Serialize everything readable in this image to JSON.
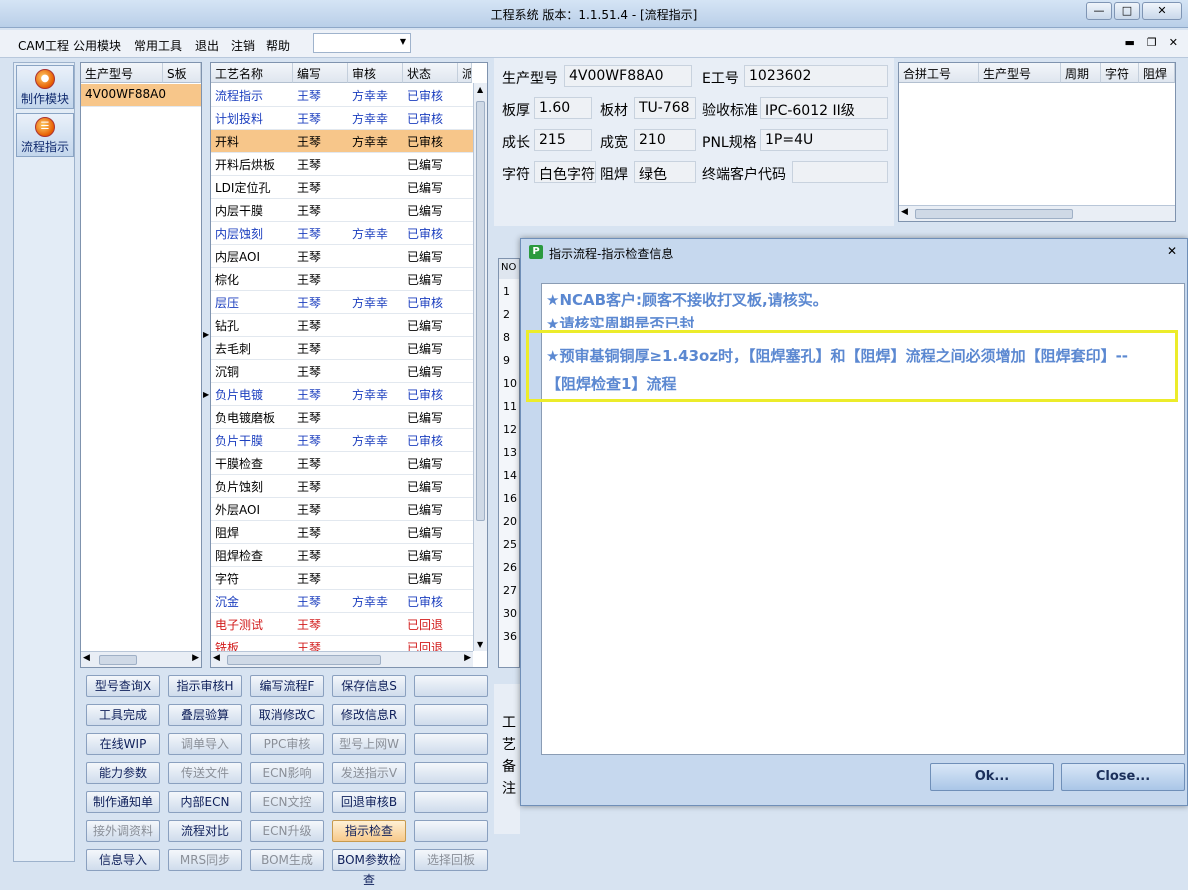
{
  "window": {
    "title": "工程系统   版本：1.1.51.4 - [流程指示]"
  },
  "menu": {
    "items": [
      "CAM工程",
      "公用模块",
      "常用工具",
      "退出",
      "注销",
      "帮助"
    ],
    "combo_value": ""
  },
  "sidebar": {
    "items": [
      {
        "label": "制作模块"
      },
      {
        "label": "流程指示"
      }
    ]
  },
  "product_list": {
    "headers": [
      "生产型号",
      "S板"
    ],
    "rows": [
      {
        "model": "4V00WF88A0",
        "s": ""
      }
    ]
  },
  "process_table": {
    "headers": [
      "工艺名称",
      "编写",
      "审核",
      "状态",
      "派"
    ],
    "rows": [
      {
        "name": "流程指示",
        "writer": "王琴",
        "reviewer": "方幸幸",
        "status": "已审核",
        "color": "blue"
      },
      {
        "name": "计划投料",
        "writer": "王琴",
        "reviewer": "方幸幸",
        "status": "已审核",
        "color": "blue"
      },
      {
        "name": "开料",
        "writer": "王琴",
        "reviewer": "方幸幸",
        "status": "已审核",
        "color": "blue"
      },
      {
        "name": "开料后烘板",
        "writer": "王琴",
        "reviewer": "",
        "status": "已编写",
        "color": ""
      },
      {
        "name": "LDI定位孔",
        "writer": "王琴",
        "reviewer": "",
        "status": "已编写",
        "color": ""
      },
      {
        "name": "内层干膜",
        "writer": "王琴",
        "reviewer": "",
        "status": "已编写",
        "color": ""
      },
      {
        "name": "内层蚀刻",
        "writer": "王琴",
        "reviewer": "方幸幸",
        "status": "已审核",
        "color": "blue"
      },
      {
        "name": "内层AOI",
        "writer": "王琴",
        "reviewer": "",
        "status": "已编写",
        "color": ""
      },
      {
        "name": "棕化",
        "writer": "王琴",
        "reviewer": "",
        "status": "已编写",
        "color": ""
      },
      {
        "name": "层压",
        "writer": "王琴",
        "reviewer": "方幸幸",
        "status": "已审核",
        "color": "blue"
      },
      {
        "name": "钻孔",
        "writer": "王琴",
        "reviewer": "",
        "status": "已编写",
        "color": ""
      },
      {
        "name": "去毛刺",
        "writer": "王琴",
        "reviewer": "",
        "status": "已编写",
        "color": ""
      },
      {
        "name": "沉铜",
        "writer": "王琴",
        "reviewer": "",
        "status": "已编写",
        "color": ""
      },
      {
        "name": "负片电镀",
        "writer": "王琴",
        "reviewer": "方幸幸",
        "status": "已审核",
        "color": "blue"
      },
      {
        "name": "负电镀磨板",
        "writer": "王琴",
        "reviewer": "",
        "status": "已编写",
        "color": ""
      },
      {
        "name": "负片干膜",
        "writer": "王琴",
        "reviewer": "方幸幸",
        "status": "已审核",
        "color": "blue"
      },
      {
        "name": "干膜检查",
        "writer": "王琴",
        "reviewer": "",
        "status": "已编写",
        "color": ""
      },
      {
        "name": "负片蚀刻",
        "writer": "王琴",
        "reviewer": "",
        "status": "已编写",
        "color": ""
      },
      {
        "name": "外层AOI",
        "writer": "王琴",
        "reviewer": "",
        "status": "已编写",
        "color": ""
      },
      {
        "name": "阻焊",
        "writer": "王琴",
        "reviewer": "",
        "status": "已编写",
        "color": ""
      },
      {
        "name": "阻焊检查",
        "writer": "王琴",
        "reviewer": "",
        "status": "已编写",
        "color": ""
      },
      {
        "name": "字符",
        "writer": "王琴",
        "reviewer": "",
        "status": "已编写",
        "color": ""
      },
      {
        "name": "沉金",
        "writer": "王琴",
        "reviewer": "方幸幸",
        "status": "已审核",
        "color": "blue"
      },
      {
        "name": "电子测试",
        "writer": "王琴",
        "reviewer": "",
        "status": "已回退",
        "color": "red"
      },
      {
        "name": "铣板",
        "writer": "王琴",
        "reviewer": "",
        "status": "已回退",
        "color": "red"
      }
    ],
    "selected_index": 2
  },
  "info": {
    "model_label": "生产型号",
    "model_value": "4V00WF88A0",
    "eno_label": "E工号",
    "eno_value": "1023602",
    "thick_label": "板厚",
    "thick_value": "1.60",
    "material_label": "板材",
    "material_value": "TU-768",
    "std_label": "验收标准",
    "std_value": "IPC-6012 II级",
    "len_label": "成长",
    "len_value": "215",
    "wid_label": "成宽",
    "wid_value": "210",
    "pnl_label": "PNL规格",
    "pnl_value": "1P=4U",
    "char_label": "字符",
    "char_value": "白色字符",
    "mask_label": "阻焊",
    "mask_value": "绿色",
    "cust_label": "终端客户代码",
    "cust_value": ""
  },
  "merge_table": {
    "headers": [
      "合拼工号",
      "生产型号",
      "周期",
      "字符",
      "阻焊"
    ]
  },
  "no_column": {
    "header": "NO",
    "values": [
      "1",
      "2",
      "8",
      "9",
      "10",
      "11",
      "12",
      "13",
      "14",
      "16",
      "20",
      "25",
      "26",
      "27",
      "30",
      "36"
    ]
  },
  "remark_label": [
    "工",
    "艺",
    "备",
    "注"
  ],
  "actions": [
    [
      "型号查询X",
      "指示审核H",
      "编写流程F",
      "保存信息S",
      ""
    ],
    [
      "工具完成",
      "叠层验算",
      "取消修改C",
      "修改信息R",
      ""
    ],
    [
      "在线WIP",
      "调单导入",
      "PPC审核",
      "型号上网W",
      ""
    ],
    [
      "能力参数",
      "传送文件",
      "ECN影响",
      "发送指示V",
      ""
    ],
    [
      "制作通知单",
      "内部ECN",
      "ECN文控",
      "回退审核B",
      ""
    ],
    [
      "接外调资料",
      "流程对比",
      "ECN升级",
      "指示检查",
      ""
    ],
    [
      "信息导入",
      "MRS同步",
      "BOM生成",
      "BOM参数检查",
      "选择回板"
    ]
  ],
  "dialog": {
    "title": "指示流程-指示检查信息",
    "messages": [
      "★NCAB客户:顾客不接收打叉板,请核实。",
      "★请核实周期是否已封",
      "★预审基铜铜厚≥1.43oz时，【阻焊塞孔】和【阻焊】流程之间必须增加【阻焊套印】--",
      "【阻焊检查1】流程"
    ],
    "ok_label": "Ok...",
    "close_label": "Close..."
  }
}
